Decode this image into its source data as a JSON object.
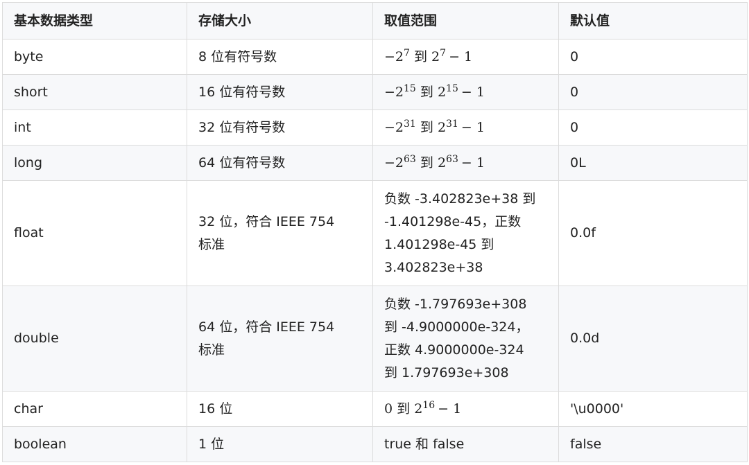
{
  "table": {
    "headers": [
      "基本数据类型",
      "存储大小",
      "取值范围",
      "默认值"
    ],
    "rows": [
      {
        "type": "byte",
        "size": "8 位有符号数",
        "range": {
          "neg_base": "−2",
          "neg_exp": "7",
          "sep": "到",
          "pos_base": "2",
          "pos_exp": "7",
          "tail": "− 1"
        },
        "default": "0"
      },
      {
        "type": "short",
        "size": "16 位有符号数",
        "range": {
          "neg_base": "−2",
          "neg_exp": "15",
          "sep": "到",
          "pos_base": "2",
          "pos_exp": "15",
          "tail": "− 1"
        },
        "default": "0"
      },
      {
        "type": "int",
        "size": "32 位有符号数",
        "range": {
          "neg_base": "−2",
          "neg_exp": "31",
          "sep": "到",
          "pos_base": "2",
          "pos_exp": "31",
          "tail": "− 1"
        },
        "default": "0"
      },
      {
        "type": "long",
        "size": "64 位有符号数",
        "range": {
          "neg_base": "−2",
          "neg_exp": "63",
          "sep": "到",
          "pos_base": "2",
          "pos_exp": "63",
          "tail": "− 1"
        },
        "default": "0L"
      },
      {
        "type": "float",
        "size_lines": [
          "32 位，符合 IEEE 754",
          "标准"
        ],
        "range_lines": [
          "负数 -3.402823e+38 到",
          "-1.401298e-45，正数",
          "1.401298e-45 到",
          "3.402823e+38"
        ],
        "default": "0.0f"
      },
      {
        "type": "double",
        "size_lines": [
          "64 位，符合 IEEE 754",
          "标准"
        ],
        "range_lines": [
          "负数 -1.797693e+308",
          "到 -4.9000000e-324，",
          "正数 4.9000000e-324",
          "到 1.797693e+308"
        ],
        "default": "0.0d"
      },
      {
        "type": "char",
        "size": "16 位",
        "range": {
          "start": "0",
          "sep": "到",
          "pos_base": "2",
          "pos_exp": "16",
          "tail": "− 1"
        },
        "default": "'\\u0000'"
      },
      {
        "type": "boolean",
        "size": "1 位",
        "range_text": "true 和 false",
        "default": "false"
      }
    ]
  }
}
